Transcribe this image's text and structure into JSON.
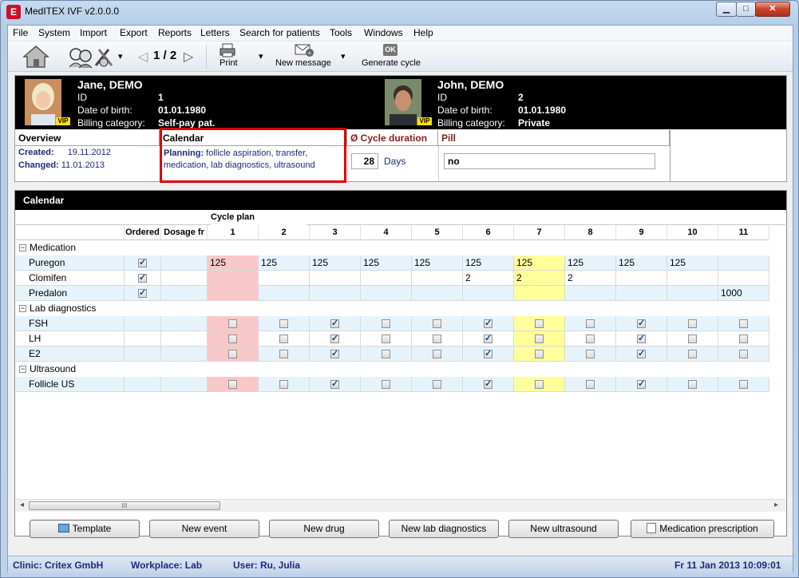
{
  "window": {
    "title": "MedITEX IVF v2.0.0.0",
    "app_icon": "E"
  },
  "menu": [
    "File",
    "System",
    "Import",
    "Export",
    "Reports",
    "Letters",
    "Search for patients",
    "Tools",
    "Windows",
    "Help"
  ],
  "toolbar": {
    "pager": "1 / 2",
    "print_label": "Print",
    "new_message_label": "New message",
    "generate_cycle_label": "Generate cycle",
    "generate_cycle_icon_text": "OK"
  },
  "patient": {
    "female": {
      "name": "Jane, DEMO",
      "id_label": "ID",
      "id": "1",
      "dob_label": "Date of birth:",
      "dob": "01.01.1980",
      "billing_label": "Billing category:",
      "billing": "Self-pay pat.",
      "vip": "VIP"
    },
    "male": {
      "name": "John, DEMO",
      "id_label": "ID",
      "id": "2",
      "dob_label": "Date of birth:",
      "dob": "01.01.1980",
      "billing_label": "Billing category:",
      "billing": "Private",
      "vip": "VIP"
    }
  },
  "overview": {
    "title": "Overview",
    "created_label": "Created:",
    "created": "19.11.2012",
    "changed_label": "Changed:",
    "changed": "11.01.2013"
  },
  "calendar_info": {
    "title": "Calendar",
    "planning_label": "Planning:",
    "planning_text_1": "follicle aspiration, transfer,",
    "planning_text_2": "medication, lab diagnostics, ultrasound"
  },
  "cycle_duration": {
    "title": "Ø Cycle duration",
    "value": "28",
    "unit": "Days"
  },
  "pill": {
    "title": "Pill",
    "value": "no"
  },
  "calendar_panel": {
    "title": "Calendar",
    "cycle_plan_label": "Cycle plan",
    "col_ordered": "Ordered",
    "col_dosage": "Dosage fr",
    "days": [
      "1",
      "2",
      "3",
      "4",
      "5",
      "6",
      "7",
      "8",
      "9",
      "10",
      "11"
    ],
    "groups": [
      {
        "name": "Medication",
        "type": "text",
        "rows": [
          {
            "name": "Puregon",
            "ordered": true,
            "values": [
              "125",
              "125",
              "125",
              "125",
              "125",
              "125",
              "125",
              "125",
              "125",
              "125",
              ""
            ]
          },
          {
            "name": "Clomifen",
            "ordered": true,
            "values": [
              "",
              "",
              "",
              "",
              "",
              "2",
              "2",
              "2",
              "",
              "",
              ""
            ]
          },
          {
            "name": "Predalon",
            "ordered": true,
            "values": [
              "",
              "",
              "",
              "",
              "",
              "",
              "",
              "",
              "",
              "",
              "1000"
            ]
          }
        ]
      },
      {
        "name": "Lab diagnostics",
        "type": "check",
        "rows": [
          {
            "name": "FSH",
            "ordered": false,
            "values": [
              false,
              false,
              true,
              false,
              false,
              true,
              false,
              false,
              true,
              false,
              false
            ]
          },
          {
            "name": "LH",
            "ordered": false,
            "values": [
              false,
              false,
              true,
              false,
              false,
              true,
              false,
              false,
              true,
              false,
              false
            ]
          },
          {
            "name": "E2",
            "ordered": false,
            "values": [
              false,
              false,
              true,
              false,
              false,
              true,
              false,
              false,
              true,
              false,
              false
            ]
          }
        ]
      },
      {
        "name": "Ultrasound",
        "type": "check",
        "rows": [
          {
            "name": "Follicle US",
            "ordered": false,
            "values": [
              false,
              false,
              true,
              false,
              false,
              true,
              false,
              false,
              true,
              false,
              false
            ]
          }
        ]
      }
    ],
    "scroll_grip": "III"
  },
  "buttons": {
    "template": "Template",
    "new_event": "New event",
    "new_drug": "New drug",
    "new_lab": "New lab diagnostics",
    "new_us": "New ultrasound",
    "med_rx": "Medication prescription"
  },
  "status": {
    "clinic": "Clinic: Critex GmbH",
    "workplace": "Workplace: Lab",
    "user": "User: Ru, Julia",
    "datetime": "Fr 11 Jan 2013 10:09:01"
  },
  "colors": {
    "highlight_today": "#ffff99",
    "day1": "#f8c8c8",
    "row_alt": "#e6f3fb",
    "red_title": "#8b1a1a",
    "frame_red": "#e00000"
  }
}
